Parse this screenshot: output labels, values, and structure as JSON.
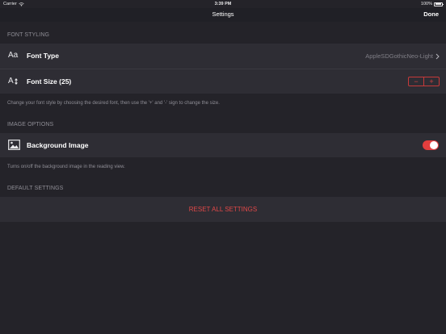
{
  "status_bar": {
    "carrier": "Carrier",
    "time": "3:39 PM",
    "battery_percent": "100%",
    "battery_level": 1.0
  },
  "nav": {
    "title": "Settings",
    "done_label": "Done"
  },
  "font_styling": {
    "header": "FONT STYLING",
    "font_type_icon_text": "Aa",
    "font_type_label": "Font Type",
    "font_type_value": "AppleSDGothicNeo-Light",
    "font_size_icon_text": "A",
    "font_size_label": "Font Size (25)",
    "minus_symbol": "−",
    "plus_symbol": "+",
    "footer": "Change your font style by choosing the desired font, then use the '+' and '-' sign to change the size."
  },
  "image_options": {
    "header": "IMAGE OPTIONS",
    "background_image_label": "Background Image",
    "background_image_on": true,
    "footer": "Turns on/off the background image in the reading view."
  },
  "default_settings": {
    "header": "DEFAULT SETTINGS",
    "reset_label": "RESET ALL SETTINGS"
  },
  "colors": {
    "background": "#242329",
    "row": "#2e2d34",
    "accent_red": "#e23e3e",
    "muted_text": "#8f8e96"
  },
  "icons": {
    "wifi": "wifi-icon",
    "battery": "battery-icon",
    "font_type": "font-type-icon",
    "font_size": "font-size-icon",
    "chevron": "chevron-right-icon",
    "background_image": "image-icon"
  }
}
